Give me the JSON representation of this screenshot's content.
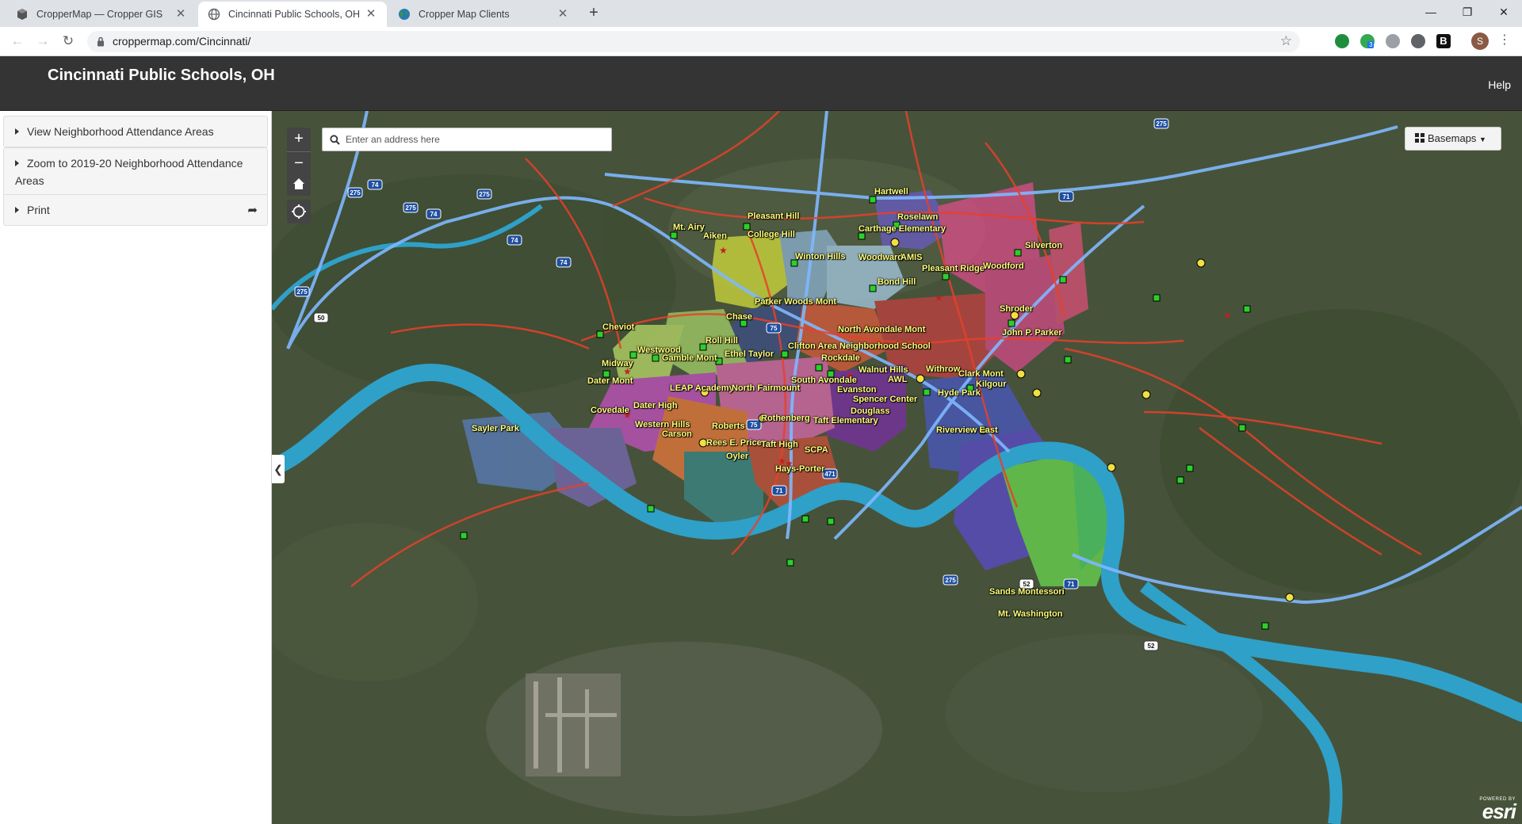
{
  "browser": {
    "tabs": [
      {
        "title": "CropperMap — Cropper GIS",
        "active": false
      },
      {
        "title": "Cincinnati Public Schools, OH",
        "active": true
      },
      {
        "title": "Cropper Map Clients",
        "active": false
      }
    ],
    "url": "croppermap.com/Cincinnati/",
    "profile_initial": "S",
    "extension_badge": "3",
    "extension_letter": "B"
  },
  "app": {
    "title": "Cincinnati Public Schools, OH",
    "help_label": "Help"
  },
  "sidebar": {
    "items": [
      {
        "label": "View Neighborhood Attendance Areas"
      },
      {
        "label": "Zoom to 2019-20 Neighborhood Attendance Areas"
      },
      {
        "label": "Print"
      }
    ]
  },
  "map": {
    "search_placeholder": "Enter an address here",
    "zoom_in": "+",
    "zoom_out": "−",
    "basemaps_label": "Basemaps",
    "attribution_powered": "POWERED BY",
    "attribution_brand": "esri",
    "schools": [
      "Hartwell",
      "Roselawn",
      "Pleasant Hill",
      "Carthage Elementary",
      "Mt. Airy",
      "Aiken",
      "College Hill",
      "Silverton",
      "Winton Hills",
      "Woodward",
      "AMIS",
      "Pleasant Ridge",
      "Woodford",
      "Bond Hill",
      "Parker Woods Mont",
      "Shroder",
      "Chase",
      "Cheviot",
      "North Avondale Mont",
      "John P. Parker",
      "Roll Hill",
      "Westwood",
      "Ethel Taylor",
      "Clifton Area Neighborhood School",
      "Gamble Mont",
      "Rockdale",
      "Midway",
      "Walnut Hills",
      "Withrow",
      "Clark Mont",
      "Dater Mont",
      "South Avondale",
      "AWL",
      "Kilgour",
      "LEAP Academy",
      "North Fairmount",
      "Evanston",
      "Hyde Park",
      "Spencer Center",
      "Covedale",
      "Dater High",
      "Douglass",
      "Rothenberg",
      "Taft Elementary",
      "Sayler Park",
      "Western Hills",
      "Roberts",
      "Riverview East",
      "Carson",
      "Rees E. Price",
      "Taft High",
      "SCPA",
      "Oyler",
      "Hays-Porter",
      "Sands Montessori",
      "Mt. Washington"
    ],
    "highways": [
      "275",
      "74",
      "275",
      "74",
      "275",
      "74",
      "74",
      "275",
      "50",
      "75",
      "75",
      "71",
      "71",
      "471",
      "275",
      "52",
      "71",
      "52",
      "275"
    ]
  }
}
